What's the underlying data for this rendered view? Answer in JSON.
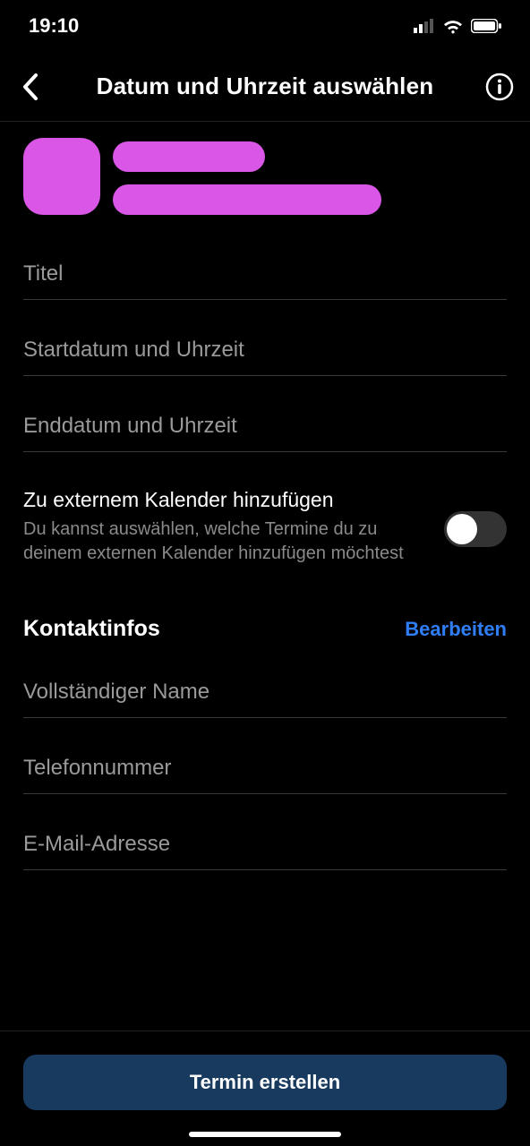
{
  "status_bar": {
    "time": "19:10"
  },
  "header": {
    "title": "Datum und Uhrzeit auswählen"
  },
  "form": {
    "title_placeholder": "Titel",
    "start_placeholder": "Startdatum und Uhrzeit",
    "end_placeholder": "Enddatum und Uhrzeit"
  },
  "toggle": {
    "title": "Zu externem Kalender hinzufügen",
    "desc": "Du kannst auswählen, welche Termine du zu deinem externen Kalender hinzufügen möchtest"
  },
  "contacts": {
    "heading": "Kontaktinfos",
    "edit_label": "Bearbeiten",
    "name_placeholder": "Vollständiger Name",
    "phone_placeholder": "Telefonnummer",
    "email_placeholder": "E-Mail-Adresse"
  },
  "cta": {
    "label": "Termin erstellen"
  }
}
